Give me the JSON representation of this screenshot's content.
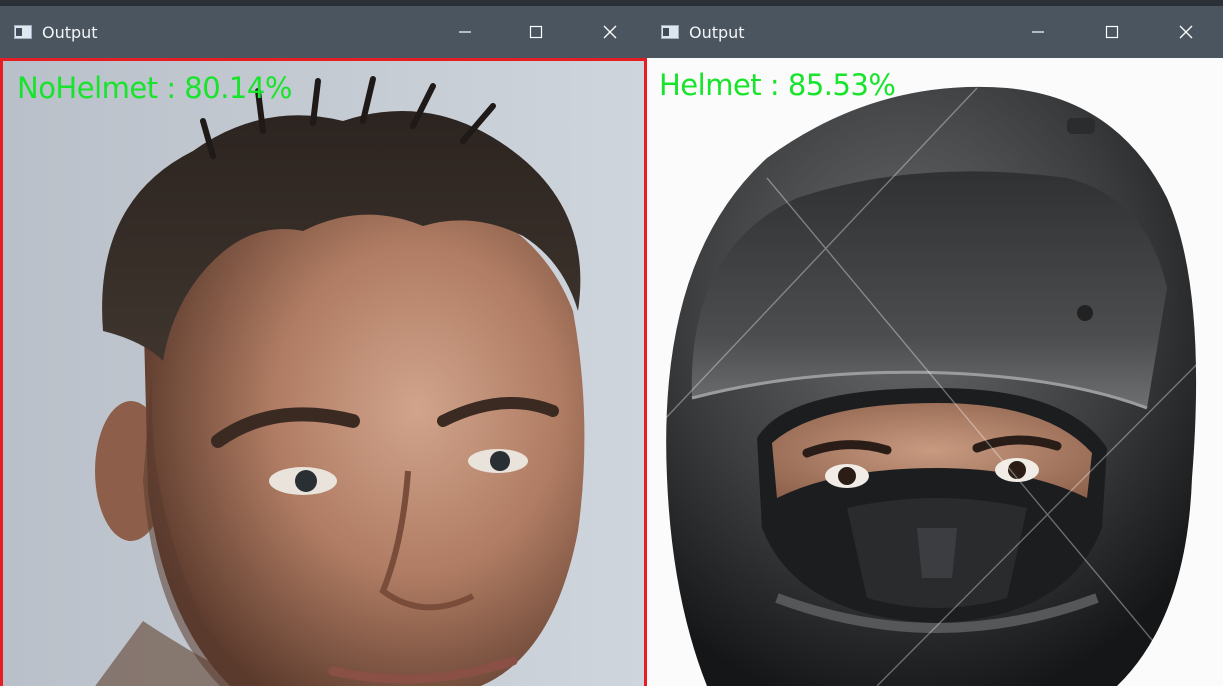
{
  "windows": [
    {
      "title": "Output",
      "label_text": "NoHelmet : 80.14%",
      "prediction_class": "NoHelmet",
      "confidence": "80.14%",
      "box_color": "#e41e24",
      "image_subject": "man without helmet"
    },
    {
      "title": "Output",
      "label_text": "Helmet : 85.53%",
      "prediction_class": "Helmet",
      "confidence": "85.53%",
      "box_color": "#e41e24",
      "image_subject": "man wearing motorcycle helmet"
    }
  ],
  "controls": {
    "minimize_icon": "minimize-icon",
    "maximize_icon": "maximize-icon",
    "close_icon": "close-icon"
  },
  "colors": {
    "titlebar": "#4a5560",
    "label_text": "#17e42b"
  }
}
